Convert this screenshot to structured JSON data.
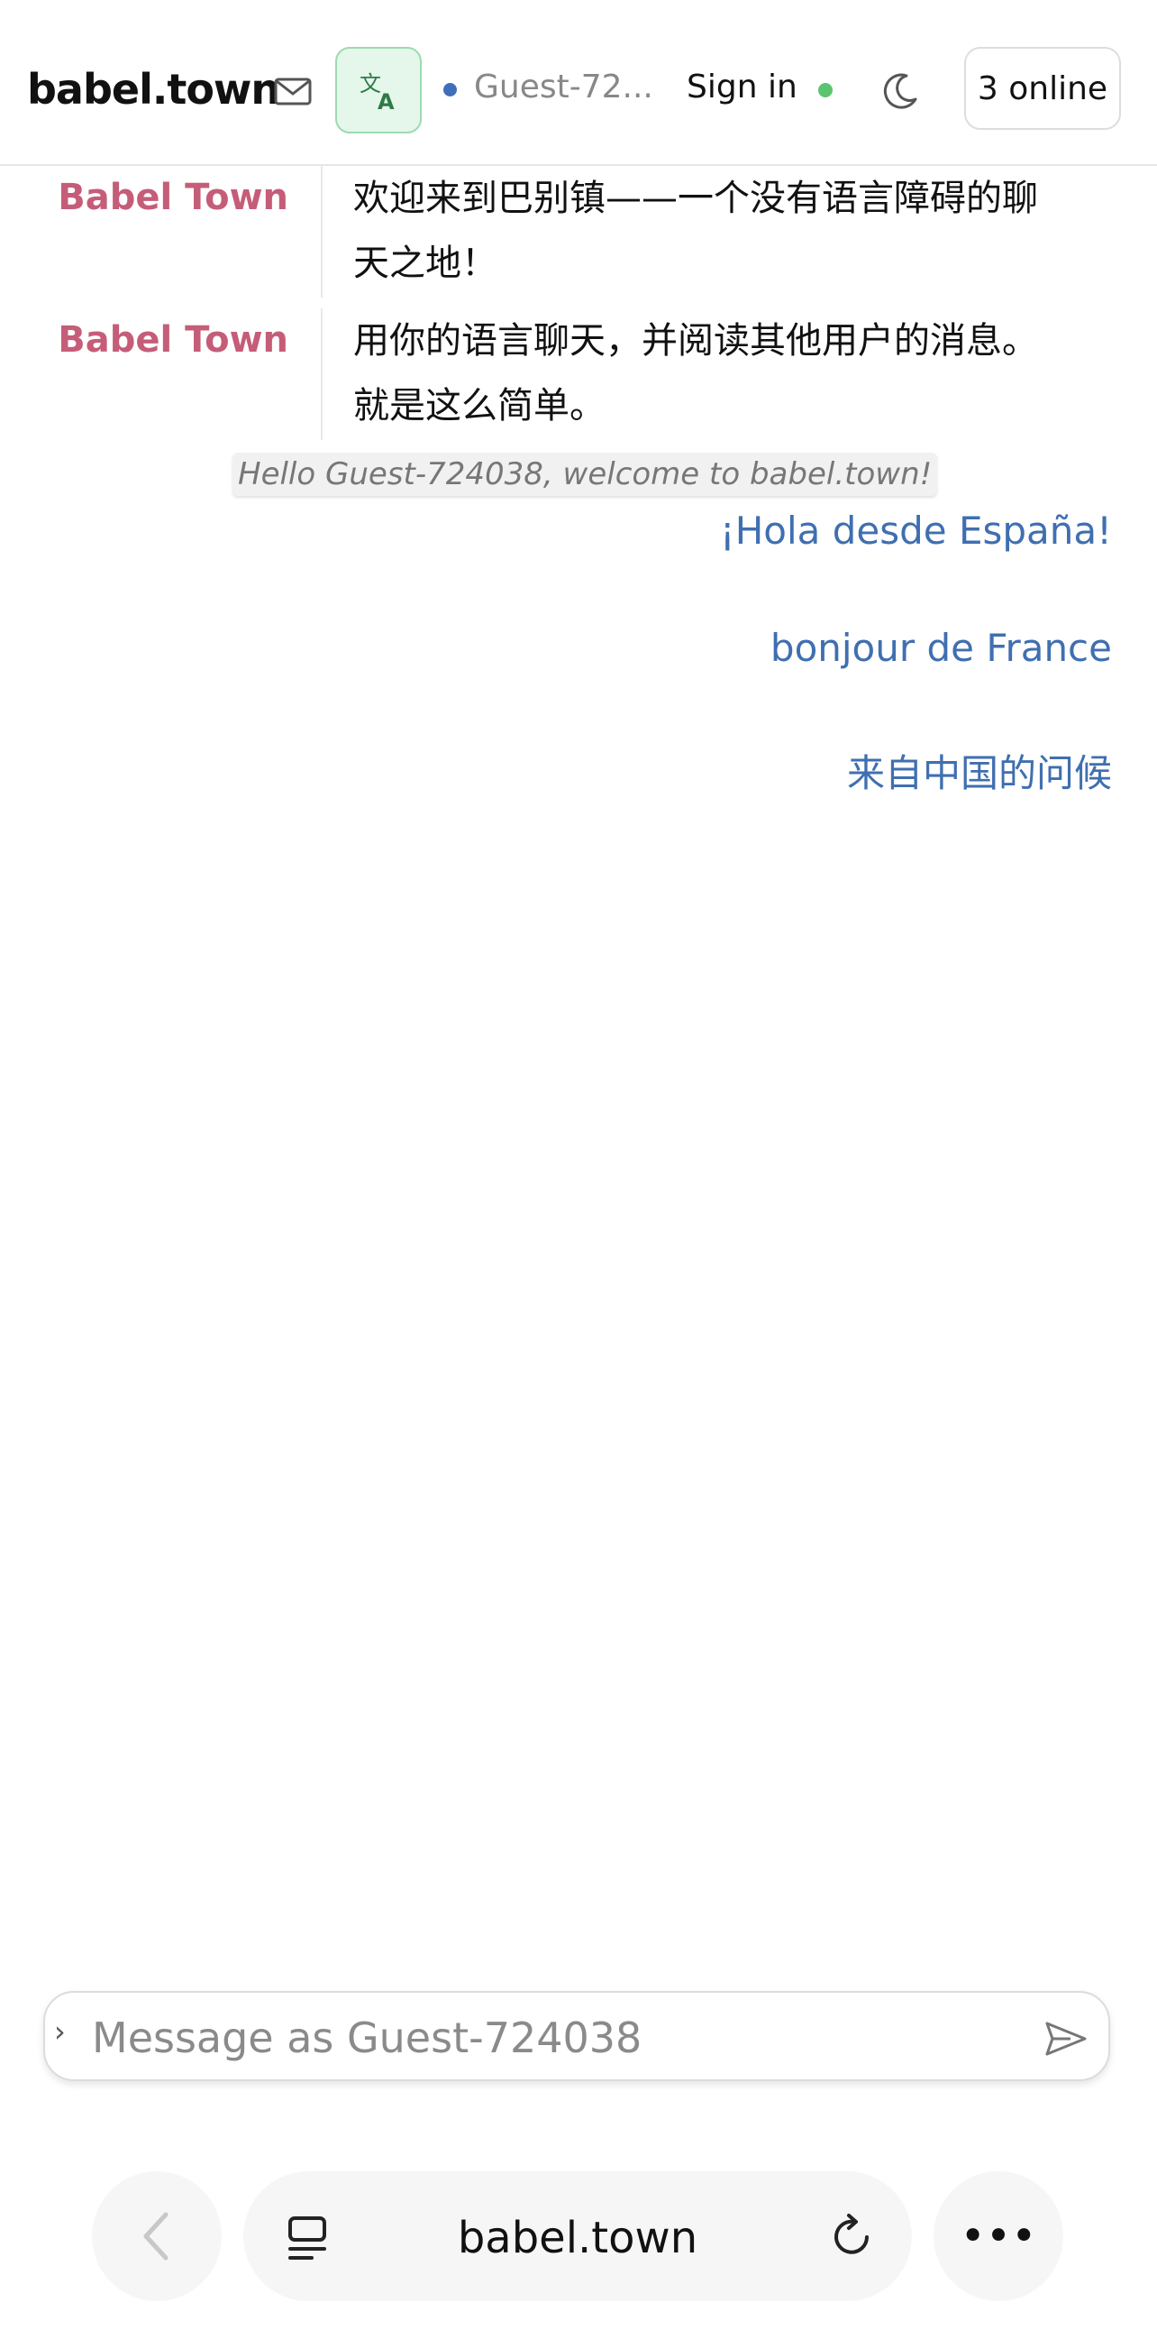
{
  "header": {
    "brand": "babel.town",
    "icons": {
      "mail": "mail-icon",
      "translate": "translate-icon",
      "theme": "moon-icon"
    },
    "user_name": "Guest-72...",
    "sign_in": "Sign in",
    "online_count": "3 online",
    "colors": {
      "translate_bg": "#e4f7ea",
      "translate_border": "#9ddab1",
      "online_dot": "#5cc46e",
      "user_dot": "#3f6fbb"
    }
  },
  "messages": [
    {
      "sender": "Babel Town",
      "text": "欢迎来到巴别镇——一个没有语言障碍的聊天之地！"
    },
    {
      "sender": "Babel Town",
      "text": "用你的语言聊天，并阅读其他用户的消息。就是这么简单。"
    }
  ],
  "system_note": "Hello Guest-724038, welcome to babel.town!",
  "own_messages": [
    "¡Hola desde España!",
    "bonjour de France",
    "来自中国的问候"
  ],
  "composer": {
    "placeholder": "Message as Guest-724038",
    "send_icon": "send-icon"
  },
  "browser": {
    "url": "babel.town",
    "icons": [
      "back-icon",
      "tabs-icon",
      "reload-icon",
      "more-icon"
    ],
    "more_label": "•••"
  },
  "colors": {
    "sender": "#c55d78",
    "own_message": "#3f6fb0"
  }
}
